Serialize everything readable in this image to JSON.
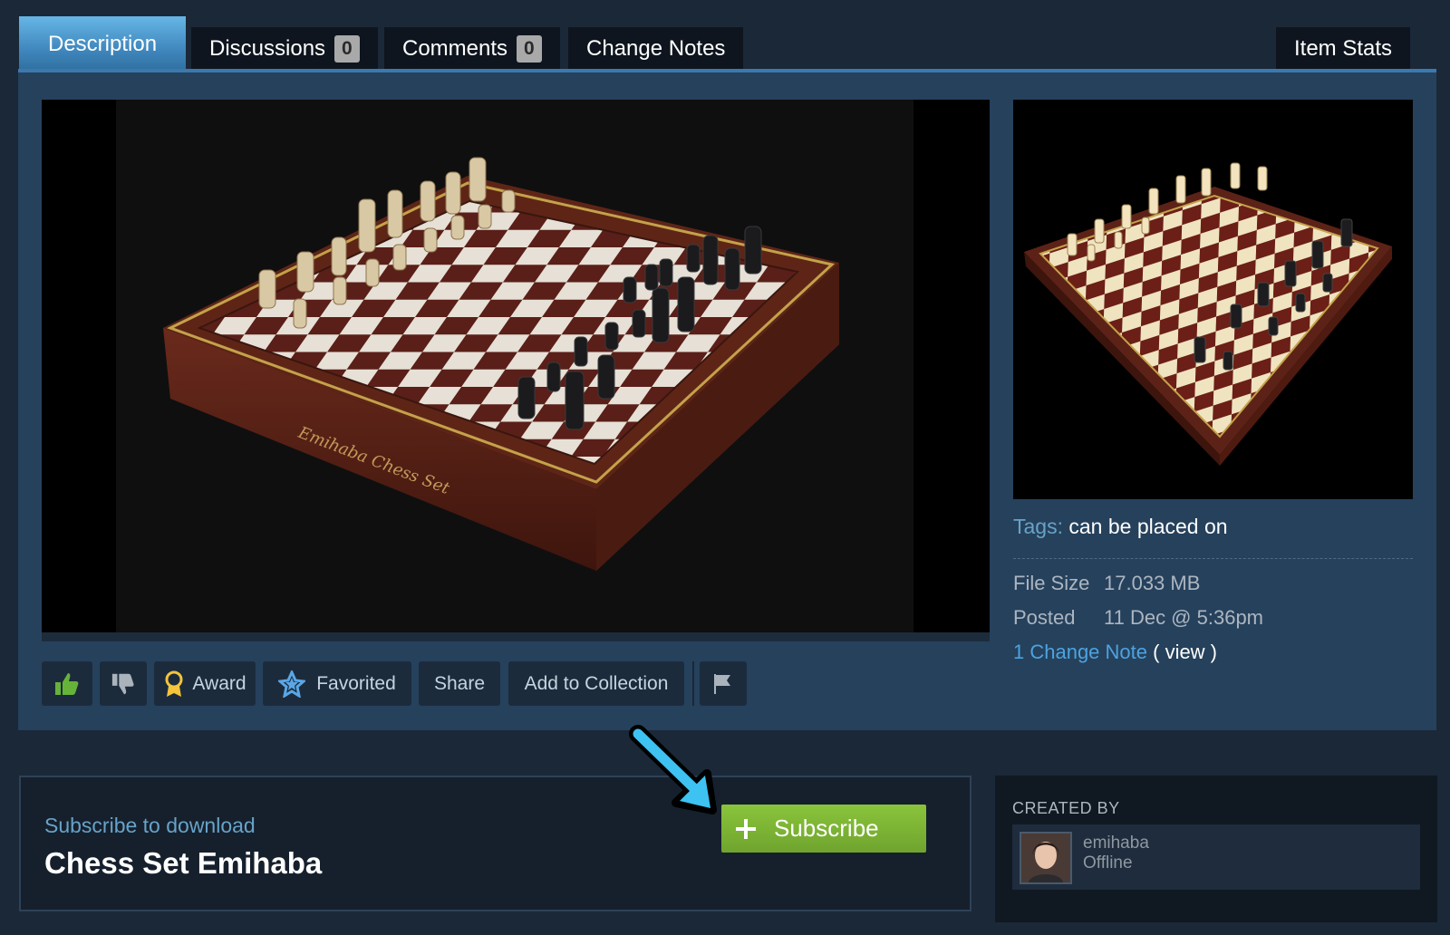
{
  "tabs": {
    "description": "Description",
    "discussions": "Discussions",
    "discussions_count": "0",
    "comments": "Comments",
    "comments_count": "0",
    "change_notes": "Change Notes",
    "item_stats": "Item Stats"
  },
  "preview": {
    "board_inscription": "Emihaba Chess Set"
  },
  "actions": {
    "award": "Award",
    "favorited": "Favorited",
    "share": "Share",
    "add_to_collection": "Add to Collection",
    "icons": [
      "thumbs-up-icon",
      "thumbs-down-icon",
      "award-icon",
      "star-icon",
      "flag-icon"
    ]
  },
  "details": {
    "tags_label": "Tags:",
    "tags_value": "can be placed on",
    "file_size_label": "File Size",
    "file_size_value": "17.033 MB",
    "posted_label": "Posted",
    "posted_value": "11 Dec @ 5:36pm",
    "change_note_link": "1 Change Note",
    "change_note_view": "( view )"
  },
  "subscribe": {
    "hint": "Subscribe to download",
    "item_title": "Chess Set Emihaba",
    "button_label": "Subscribe"
  },
  "creator": {
    "header": "CREATED BY",
    "name": "emihaba",
    "status": "Offline"
  },
  "colors": {
    "page_bg": "#1b2838",
    "panel_bg": "#26415c",
    "accent_blue": "#3f87bd",
    "subscribe_green": "#75b022",
    "link_blue": "#4ca3e0",
    "annotation_arrow": "#3dc2f2"
  }
}
